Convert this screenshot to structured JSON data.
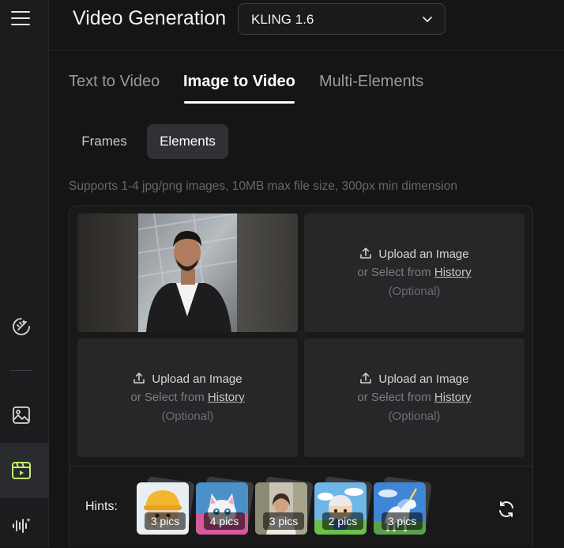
{
  "sidebar": {
    "icons": [
      "menu-icon",
      "magic-brush-icon",
      "image-icon",
      "video-icon",
      "audio-wave-icon"
    ],
    "accent": "#c6f06c"
  },
  "header": {
    "title": "Video Generation",
    "model": "KLING 1.6"
  },
  "tabs": [
    {
      "label": "Text to Video",
      "active": false
    },
    {
      "label": "Image to Video",
      "active": true
    },
    {
      "label": "Multi-Elements",
      "active": false
    }
  ],
  "subtabs": [
    {
      "label": "Frames",
      "active": false
    },
    {
      "label": "Elements",
      "active": true
    }
  ],
  "upload_hint": "Supports 1-4 jpg/png images, 10MB max file size, 300px min dimension",
  "upload_slot": {
    "title": "Upload an Image",
    "select_prefix": "or Select from ",
    "history_link": "History",
    "optional": "(Optional)"
  },
  "hints": {
    "label": "Hints:",
    "cards": [
      {
        "count": "3 pics",
        "icon": "worker-toy-thumbnail"
      },
      {
        "count": "4 pics",
        "icon": "cat-thumbnail"
      },
      {
        "count": "3 pics",
        "icon": "woman-portrait-thumbnail"
      },
      {
        "count": "2 pics",
        "icon": "toy-figure-thumbnail"
      },
      {
        "count": "3 pics",
        "icon": "unicorn-thumbnail"
      }
    ]
  }
}
